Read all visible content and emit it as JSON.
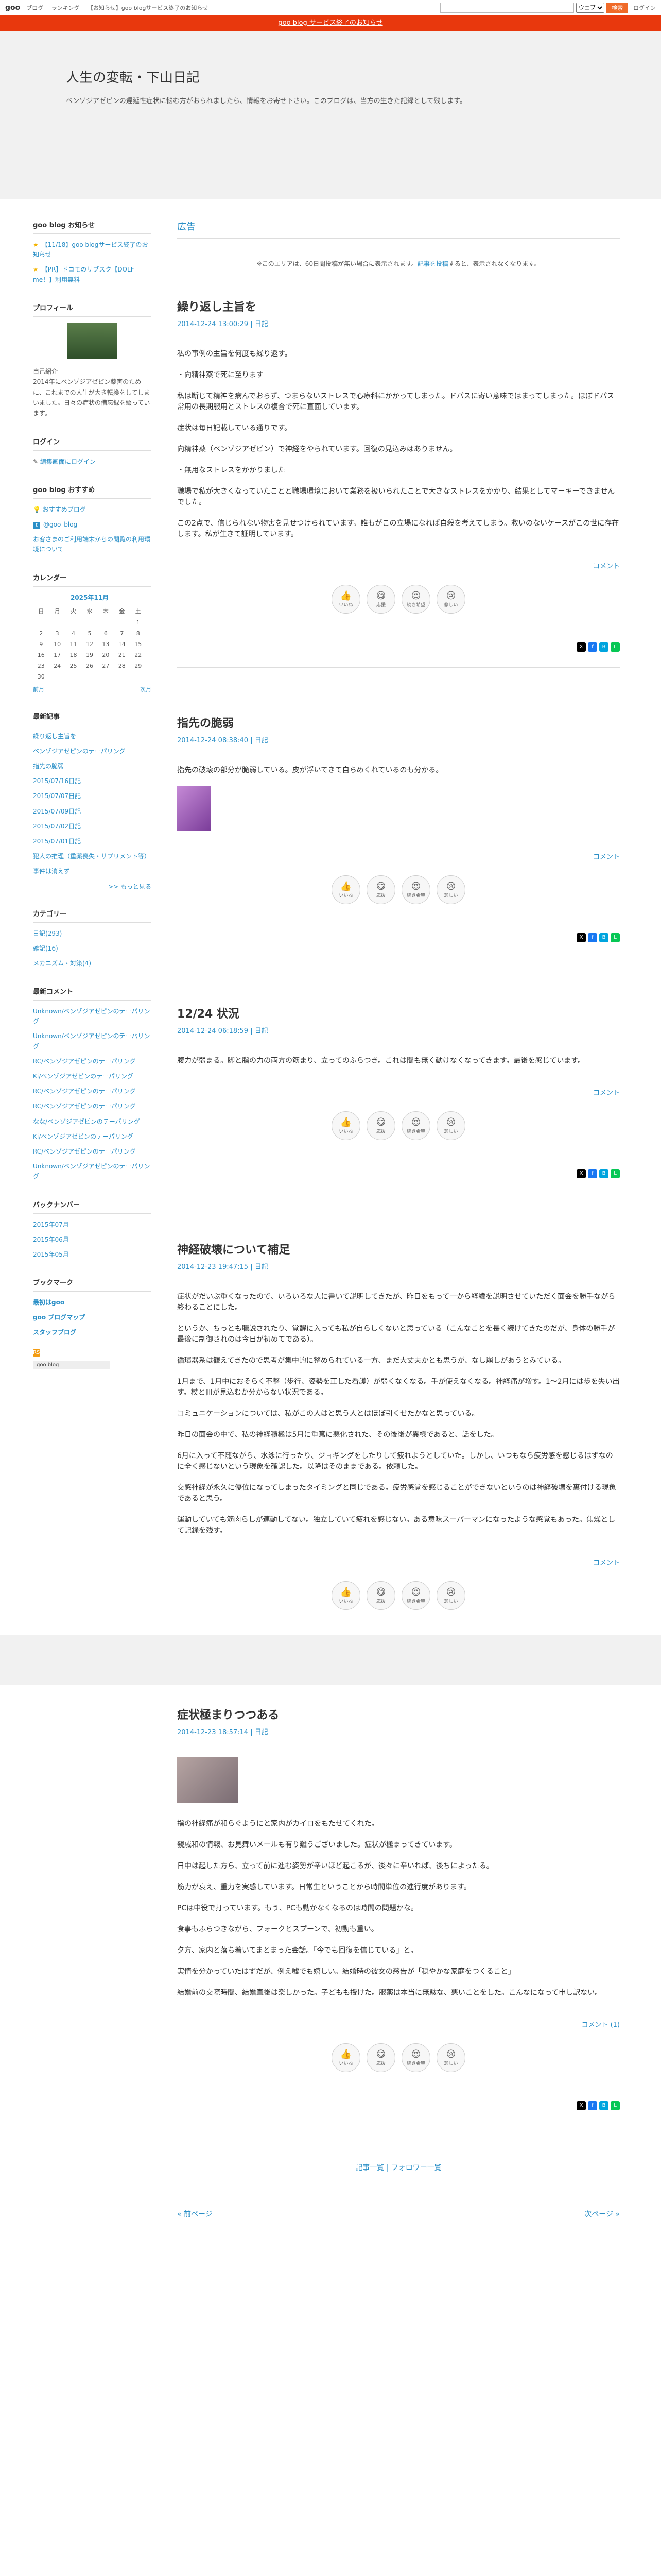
{
  "topbar": {
    "logo": "goo",
    "nav": [
      "ブログ",
      "ランキング",
      "【お知らせ】goo blogサービス終了のお知らせ"
    ],
    "search_placeholder": "",
    "search_scope": "ウェブ",
    "search_button": "検索",
    "login": "ログイン"
  },
  "notice": "goo blog サービス終了のお知らせ",
  "header": {
    "title": "人生の変転・下山日記",
    "desc": "ベンゾジアゼピンの遅延性症状に悩む方がおられましたら、情報をお寄せ下さい。このブログは、当方の生きた記録として残します。"
  },
  "sidebar": {
    "notice_title": "goo blog お知らせ",
    "notices": [
      "【11/18】goo blogサービス終了のお知らせ",
      "【PR】ドコモのサブスク【DOLF me！】利用無料"
    ],
    "profile_title": "プロフィール",
    "profile_name": "自己紹介",
    "profile_text": "2014年にベンゾジアゼピン薬害のために、これまでの人生が大き転換をしてしまいました。日々の症状の備忘録を綴っています。",
    "login_title": "ログイン",
    "login_link": "編集画面にログイン",
    "recommend_title": "goo blog おすすめ",
    "recommend": [
      "おすすめブログ",
      "@goo_blog",
      "お客さまのご利用端末からの閲覧の利用環境について"
    ],
    "calendar_title": "カレンダー",
    "calendar_caption": "2025年11月",
    "weekdays": [
      "日",
      "月",
      "火",
      "水",
      "木",
      "金",
      "土"
    ],
    "weeks": [
      [
        "",
        "",
        "",
        "",
        "",
        "",
        "1"
      ],
      [
        "2",
        "3",
        "4",
        "5",
        "6",
        "7",
        "8"
      ],
      [
        "9",
        "10",
        "11",
        "12",
        "13",
        "14",
        "15"
      ],
      [
        "16",
        "17",
        "18",
        "19",
        "20",
        "21",
        "22"
      ],
      [
        "23",
        "24",
        "25",
        "26",
        "27",
        "28",
        "29"
      ],
      [
        "30",
        "",
        "",
        "",
        "",
        "",
        ""
      ]
    ],
    "cal_prev": "前月",
    "cal_next": "次月",
    "recent_title": "最新記事",
    "recent": [
      "繰り返し主旨を",
      "ベンゾジアゼピンのテーパリング",
      "指先の脆弱",
      "2015/07/16日記",
      "2015/07/07日記",
      "2015/07/09日記",
      "2015/07/02日記",
      "2015/07/01日記",
      "犯人の推理（重薬喪失・サプリメント等）",
      "事件は消えず"
    ],
    "recent_more": ">> もっと見る",
    "category_title": "カテゴリー",
    "categories": [
      "日記(293)",
      "雑記(16)",
      "メカニズム・対策(4)"
    ],
    "comments_title": "最新コメント",
    "comments": [
      "Unknown/ベンゾジアゼピンのテーパリング",
      "Unknown/ベンゾジアゼピンのテーパリング",
      "RC/ベンゾジアゼピンのテーパリング",
      "Ki/ベンゾジアゼピンのテーパリング",
      "RC/ベンゾジアゼピンのテーパリング",
      "RC/ベンゾジアゼピンのテーパリング",
      "なな/ベンゾジアゼピンのテーパリング",
      "Ki/ベンゾジアゼピンのテーパリング",
      "RC/ベンゾジアゼピンのテーパリング",
      "Unknown/ベンゾジアゼピンのテーパリング"
    ],
    "backnumber_title": "バックナンバー",
    "backnumbers": [
      "2015年07月",
      "2015年06月",
      "2015年05月"
    ],
    "bookmark_title": "ブックマーク",
    "bookmarks": [
      "最初はgoo",
      "goo ブログマップ",
      "スタッフブログ"
    ],
    "rss": "RSS",
    "goo_badge": "goo blog"
  },
  "main": {
    "ad_title": "広告",
    "ad_note": "※このエリアは、60日間投稿が無い場合に表示されます。",
    "ad_link": "記事を投稿",
    "ad_note_tail": "すると、表示されなくなります。",
    "entries": [
      {
        "title": "繰り返し主旨を",
        "date": "2014-12-24 13:00:29",
        "category": "日記",
        "paras": [
          "私の事例の主旨を何度も繰り返す。",
          "・向精神薬で死に至ります",
          "私は断じて精神を病んでおらず、つまらないストレスで心療科にかかってしまった。ドパスに寄い意味ではまってしまった。ほぼドパス常用の長期服用とストレスの複合で死に直面しています。",
          "症状は毎日記載している通りです。",
          "向精神薬（ベンゾジアゼピン）で神経をやられています。回復の見込みはありません。",
          "・無用なストレスをかかりました",
          "職場で私が大きくなっていたことと職場環境において業務を扱いられたことで大きなストレスをかかり、結果としてマーキーできませんでした。",
          "この2点で、信じられない物害を見せつけられています。誰もがこの立場になれば自殺を考えてしまう。救いのないケースがこの世に存在します。私が生きて証明しています。"
        ],
        "comment": "コメント"
      },
      {
        "title": "指先の脆弱",
        "date": "2014-12-24 08:38:40",
        "category": "日記",
        "paras": [
          "指先の破壊の部分が脆弱している。皮が浮いてきて自らめくれているのも分かる。"
        ],
        "comment": "コメント"
      },
      {
        "title": "12/24 状況",
        "date": "2014-12-24 06:18:59",
        "category": "日記",
        "paras": [
          "腹力が弱まる。脚と脂の力の両方の筋まり、立ってのふらつき。これは間も無く動けなくなってきます。最後を感じています。"
        ],
        "comment": "コメント"
      },
      {
        "title": "神経破壊について補足",
        "date": "2014-12-23 19:47:15",
        "category": "日記",
        "paras": [
          "症状がだいぶ重くなったので、いろいろな人に書いて説明してきたが、昨日をもって一から経緯を説明させていただく面会を勝手ながら終わることにした。",
          "というか、ちっとも聴説されたり、覚醒に入っても私が自らしくないと思っている（こんなことを長く続けてきたのだが、身体の勝手が最後に制御されのは今日が初めてである）。",
          "循環器系は観えてきたので思考が集中的に整められている一方、まだ大丈夫かとも思うが、なし崩しがあうとみている。",
          "1月まで、1月中におそらく不整（歩行、姿勢を正した看護）が弱くなくなる。手が使えなくなる。神経痛が増す。1～2月には歩を失い出す。杖と冊が見込むか分からない状況である。",
          "コミュニケーションについては、私がこの人はと思う人とはほぼ引くせたかなと思っている。",
          "昨日の面会の中で、私の神経積極は5月に重篤に悪化された、その後後が異様であると、話をした。",
          "6月に入って不随ながら、水泳に行ったり、ジョギングをしたりして疲れようとしていた。しかし、いつもなら疲労感を感じるはずなのに全く感じないという現象を確認した。以降はそのままである。依頼した。",
          "交感神経が永久に優位になってしまったタイミングと同じである。疲労感覚を感じることができないというのは神経破壊を裏付ける現象であると思う。",
          "運動していても筋肉らしが連動してない。独立していて疲れを感じない。ある意味スーパーマンになったような感覚もあった。焦燥として記録を残す。"
        ],
        "comment": "コメント"
      },
      {
        "title": "症状極まりつつある",
        "date": "2014-12-23 18:57:14",
        "category": "日記",
        "paras": [
          "指の神経痛が和らぐようにと家内がカイロをもたせてくれた。",
          "親戚和の情報、お見舞いメールも有り難うございました。症状が極まってきています。",
          "日中は起した方ら、立って前に進む姿勢が辛いほど起こるが、後々に辛いれば、後ちによったる。",
          "筋力が衰え、重力を実感しています。日常生ということから時間単位の進行度があります。",
          "PCは中役で打っています。もう、PCも動かなくなるのは時間の問題かな。",
          "食事もふらつきながら、フォークとスプーンで、初動も重い。",
          "夕方、家内と落ち着いてまとまった会話。「今でも回復を信じている」と。",
          "実情を分かっていたはずだが、例え嘘でも嬉しい。結婚時の彼女の慈告が「穏やかな家庭をつくること」",
          "結婚前の交際時間、結婚直後は楽しかった。子どもも授けた。服薬は本当に無駄な、悪いことをした。こんなになって申し訳ない。"
        ],
        "comment": "コメント (1)"
      }
    ],
    "reactions": [
      {
        "emoji": "👍",
        "label": "いいね"
      },
      {
        "emoji": "😋",
        "label": "応援"
      },
      {
        "emoji": "😍",
        "label": "続き希望"
      },
      {
        "emoji": "😢",
        "label": "悲しい"
      }
    ],
    "footer_nav": "記事一覧 | フォロワー一覧",
    "prev_page": "« 前ページ",
    "next_page": "次ページ »"
  },
  "colors": {
    "accent": "#2a8fc7",
    "notice": "#e8380d",
    "search": "#f06a28"
  }
}
